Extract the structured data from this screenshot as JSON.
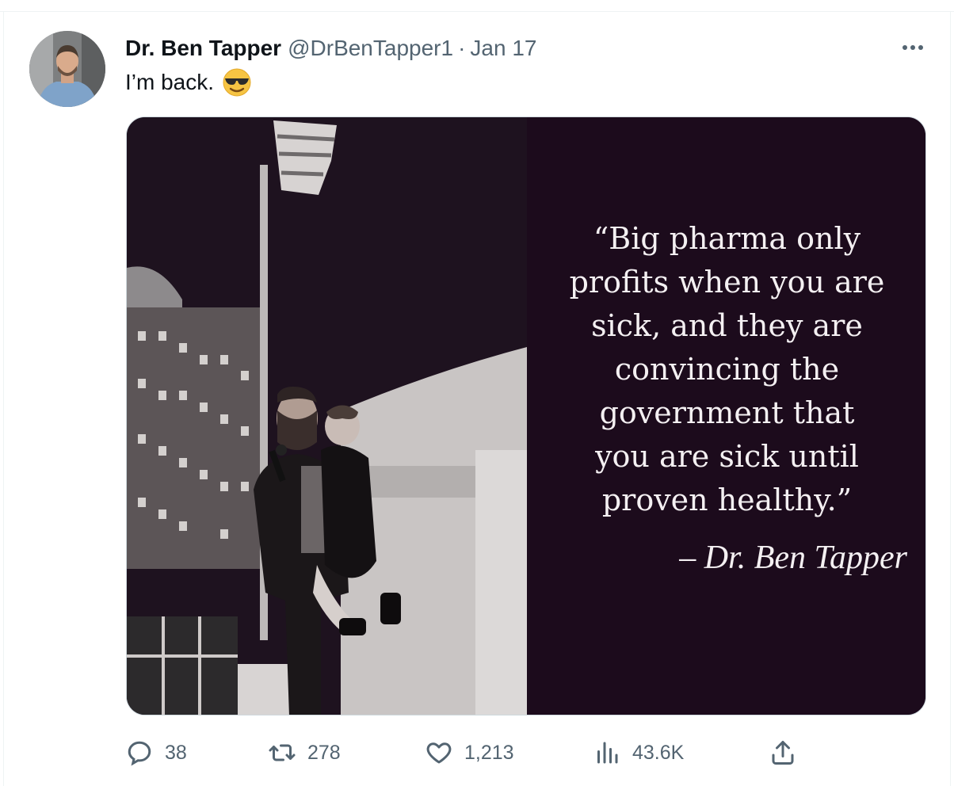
{
  "tweet": {
    "author_name": "Dr. Ben Tapper",
    "handle": "@DrBenTapper1",
    "separator": "·",
    "date": "Jan 17",
    "text": "I’m back.",
    "emoji": "smiling-face-with-sunglasses-icon"
  },
  "media": {
    "quote": "“Big pharma only\nprofits when you are\nsick, and they are\nconvincing the\ngovernment that\nyou are sick until\nproven healthy.”",
    "attribution": "– Dr. Ben Tapper"
  },
  "actions": {
    "replies": "38",
    "retweets": "278",
    "likes": "1,213",
    "views": "43.6K"
  },
  "icons": {
    "more": "more-options-icon",
    "reply": "reply-icon",
    "retweet": "retweet-icon",
    "like": "heart-icon",
    "views": "views-chart-icon",
    "share": "share-icon"
  },
  "colors": {
    "text": "#0f1419",
    "secondary": "#536471",
    "border": "#cfd9de",
    "panel": "#1c0b1c"
  }
}
